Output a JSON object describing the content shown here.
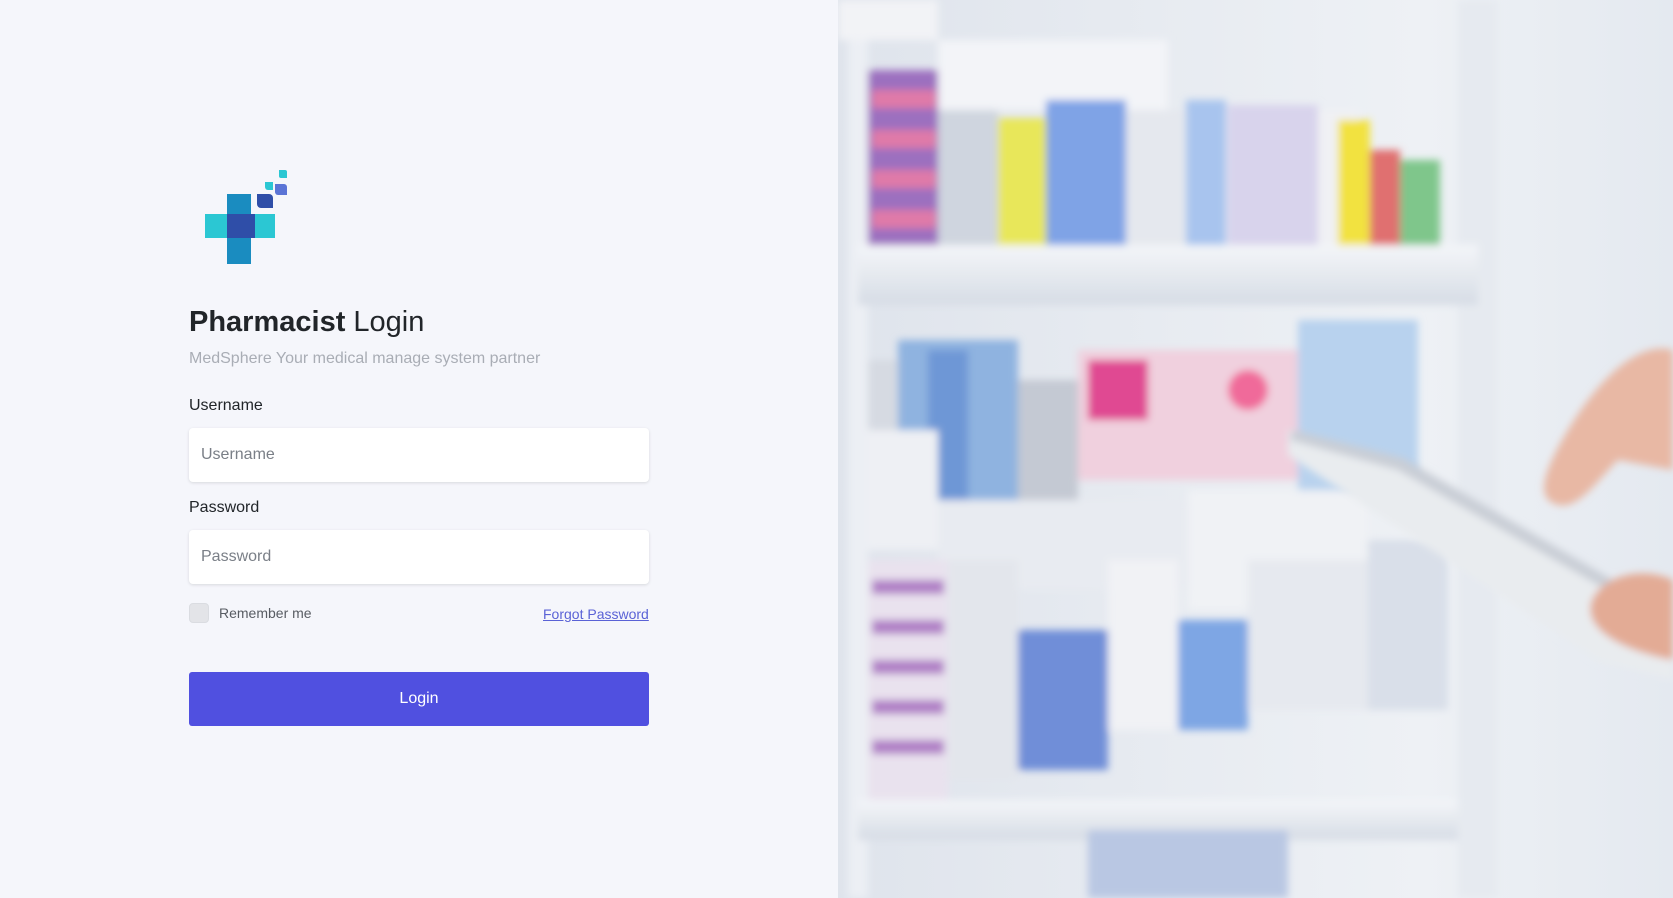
{
  "app": {
    "title_bold": "Pharmacist",
    "title_rest": " Login",
    "subtitle": "MedSphere Your medical manage system partner"
  },
  "logo": {
    "icon": "medical-cross-logo-icon",
    "colors": [
      "#2bc7d3",
      "#2f4ea8",
      "#1a8cc0",
      "#5b74d6"
    ]
  },
  "form": {
    "username_label": "Username",
    "username_placeholder": "Username",
    "username_value": "",
    "password_label": "Password",
    "password_placeholder": "Password",
    "password_value": "",
    "remember_label": "Remember me",
    "remember_checked": false,
    "forgot_label": "Forgot Password",
    "login_label": "Login"
  },
  "colors": {
    "background": "#f5f6fb",
    "accent": "#5050e0",
    "link": "#5a62d6",
    "muted_text": "#a9adb5"
  },
  "hero_image": {
    "icon": "pharmacy-shelves-photo"
  }
}
